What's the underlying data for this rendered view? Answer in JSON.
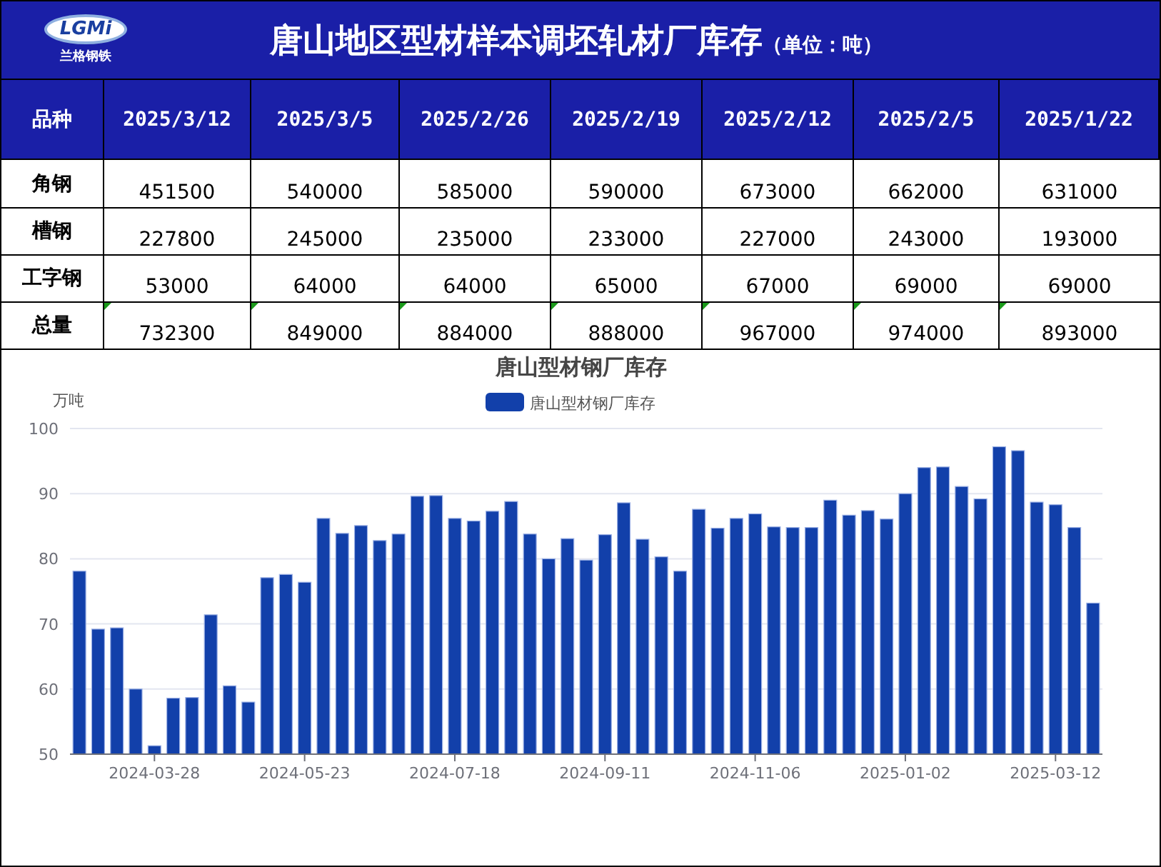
{
  "header": {
    "logo_text": "LGMi",
    "logo_caption": "兰格钢铁",
    "title": "唐山地区型材样本调坯轧材厂库存",
    "unit": "（单位：吨）"
  },
  "table": {
    "columns": [
      "品种",
      "2025/3/12",
      "2025/3/5",
      "2025/2/26",
      "2025/2/19",
      "2025/2/12",
      "2025/2/5",
      "2025/1/22"
    ],
    "rows": [
      {
        "cells": [
          "角钢",
          "451500",
          "540000",
          "585000",
          "590000",
          "673000",
          "662000",
          "631000"
        ],
        "flagged": false
      },
      {
        "cells": [
          "槽钢",
          "227800",
          "245000",
          "235000",
          "233000",
          "227000",
          "243000",
          "193000"
        ],
        "flagged": false
      },
      {
        "cells": [
          "工字钢",
          "53000",
          "64000",
          "64000",
          "65000",
          "67000",
          "69000",
          "69000"
        ],
        "flagged": false
      },
      {
        "cells": [
          "总量",
          "732300",
          "849000",
          "884000",
          "888000",
          "967000",
          "974000",
          "893000"
        ],
        "flagged": true
      }
    ]
  },
  "chart": {
    "x_axis_labels": [
      "2024-03-28",
      "2024-05-23",
      "2024-07-18",
      "2024-09-11",
      "2024-11-06",
      "2025-01-02",
      "2025-03-12"
    ],
    "chart_data": {
      "type": "bar",
      "title": "唐山型材钢厂库存",
      "ylabel": "万吨",
      "ylim": [
        50,
        100
      ],
      "yticks": [
        50,
        60,
        70,
        80,
        90,
        100
      ],
      "grid": true,
      "series": [
        {
          "name": "唐山型材钢厂库存",
          "color": "#1240aa",
          "values": [
            78.1,
            69.2,
            69.4,
            60.0,
            51.3,
            58.6,
            58.7,
            71.4,
            60.5,
            58.0,
            77.1,
            77.6,
            76.4,
            86.2,
            83.9,
            85.1,
            82.8,
            83.8,
            89.6,
            89.7,
            86.2,
            85.8,
            87.3,
            88.8,
            83.8,
            80.0,
            83.1,
            79.8,
            83.7,
            88.6,
            83.0,
            80.3,
            78.1,
            87.6,
            84.7,
            86.2,
            86.9,
            84.9,
            84.8,
            84.8,
            89.0,
            86.7,
            87.4,
            86.1,
            90.0,
            94.0,
            94.1,
            91.1,
            89.2,
            97.2,
            96.6,
            88.7,
            88.3,
            84.8,
            73.2
          ]
        }
      ]
    }
  }
}
